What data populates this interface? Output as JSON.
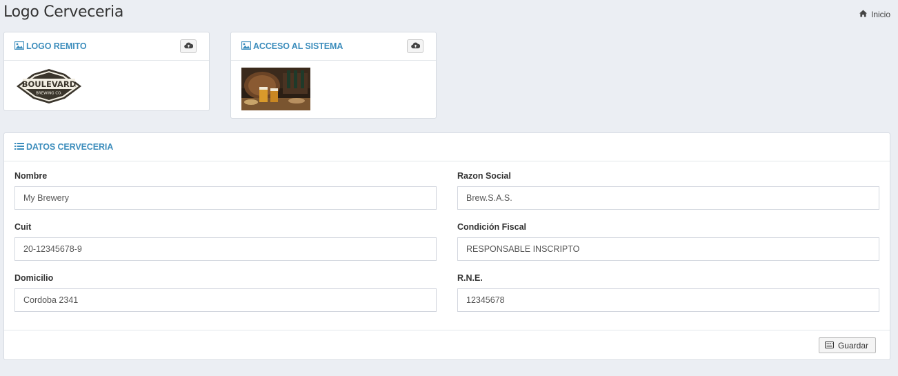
{
  "page": {
    "title": "Logo Cerveceria"
  },
  "breadcrumb": {
    "home_label": "Inicio"
  },
  "logo_remito": {
    "title": "LOGO REMITO",
    "logo_text_top": "BOULEVARD",
    "logo_text_bottom": "BREWING CO."
  },
  "acceso": {
    "title": "ACCESO AL SISTEMA"
  },
  "datos": {
    "title": "DATOS CERVECERIA",
    "fields": [
      {
        "label": "Nombre",
        "value": "My Brewery"
      },
      {
        "label": "Razon Social",
        "value": "Brew.S.A.S."
      },
      {
        "label": "Cuit",
        "value": "20-12345678-9"
      },
      {
        "label": "Condición Fiscal",
        "value": "RESPONSABLE INSCRIPTO"
      },
      {
        "label": "Domicilio",
        "value": "Cordoba 2341"
      },
      {
        "label": "R.N.E.",
        "value": "12345678"
      }
    ],
    "save_label": "Guardar"
  },
  "colors": {
    "accent": "#3c8dbc",
    "background": "#ebeef3"
  },
  "icons": [
    "home-icon",
    "image-icon",
    "cloud-upload-icon",
    "list-icon",
    "keyboard-icon"
  ]
}
